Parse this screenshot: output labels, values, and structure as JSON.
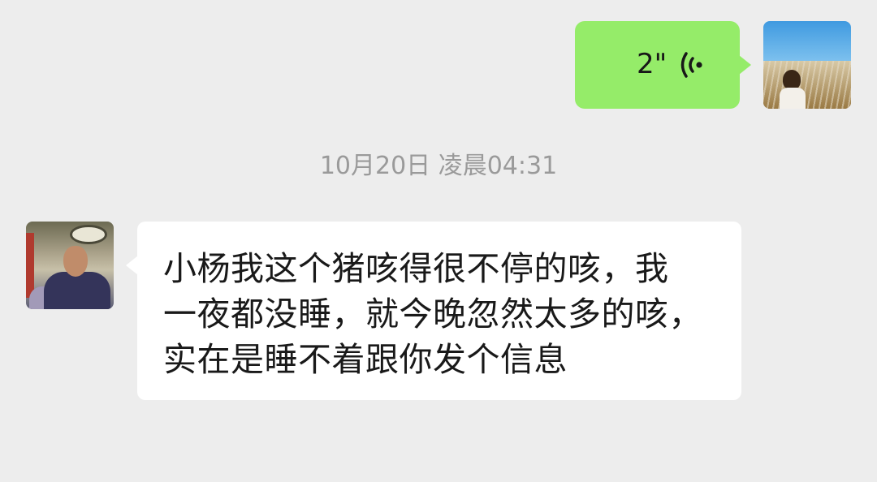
{
  "messages": {
    "outgoing_voice": {
      "duration": "2\"",
      "icon": "voice-playback-icon",
      "bubble_color": "#95ec69"
    },
    "timestamp": "10月20日 凌晨04:31",
    "incoming_text": {
      "lines": [
        "小杨我这个猪咳得很不停的咳，我",
        "一夜都没睡，就今晚忽然太多的咳，",
        "实在是睡不着跟你发个信息"
      ],
      "bubble_color": "#ffffff"
    }
  },
  "colors": {
    "background": "#ededed",
    "timestamp_text": "#9a9a9a"
  }
}
